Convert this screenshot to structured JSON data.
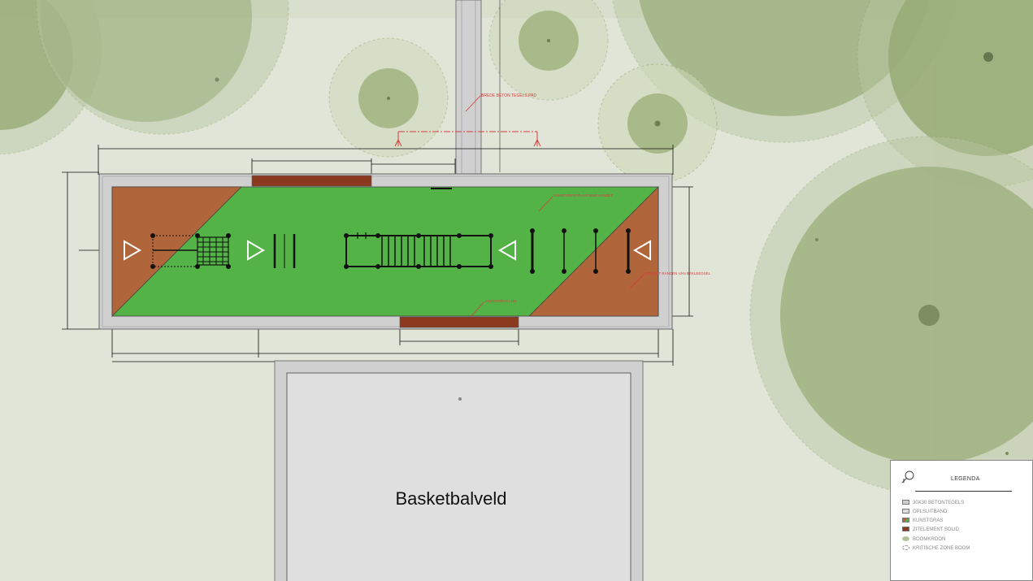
{
  "field_label": "Basketbalveld",
  "annotations": {
    "concrete_path": "BREDE BETON TEGELS PAD",
    "turf_edge_top": "KUNSTGRAS PLAATSING AANZET",
    "turf_edge_bottom": "KUNSTGRAS LIJN",
    "rubber_edge": "OPSLUIT RANDEN VAN BEKLEEDSEL"
  },
  "legend": {
    "title": "LEGENDA",
    "items": [
      {
        "label": "30X30 BETONTEGELS",
        "color": "#cfcfcf",
        "shape": "rect"
      },
      {
        "label": "OPLSUITBAND",
        "color": "#dcdcdc",
        "shape": "rect"
      },
      {
        "label": "KUNSTGRAS",
        "color": "#54b347",
        "shape": "rect"
      },
      {
        "label": "ZITELEMENT SOLID",
        "color": "#8b3a1f",
        "shape": "rect"
      },
      {
        "label": "BOOMKROON",
        "color": "#b3c49d",
        "shape": "circle"
      },
      {
        "label": "KRITISCHE ZONE BOOM",
        "color": "#a4b48c",
        "shape": "dashed"
      }
    ]
  },
  "colors": {
    "background": "#e0e5d7",
    "tree_crown": "#8fa66c",
    "critical_zone": "#a9b98d",
    "paving": "#d0d0d0",
    "turf": "#54b347",
    "rubber": "#b1653a",
    "bench": "#8b3a1f",
    "basketball_court": "#dfdfdf",
    "annotation_red": "#d43d3d"
  }
}
